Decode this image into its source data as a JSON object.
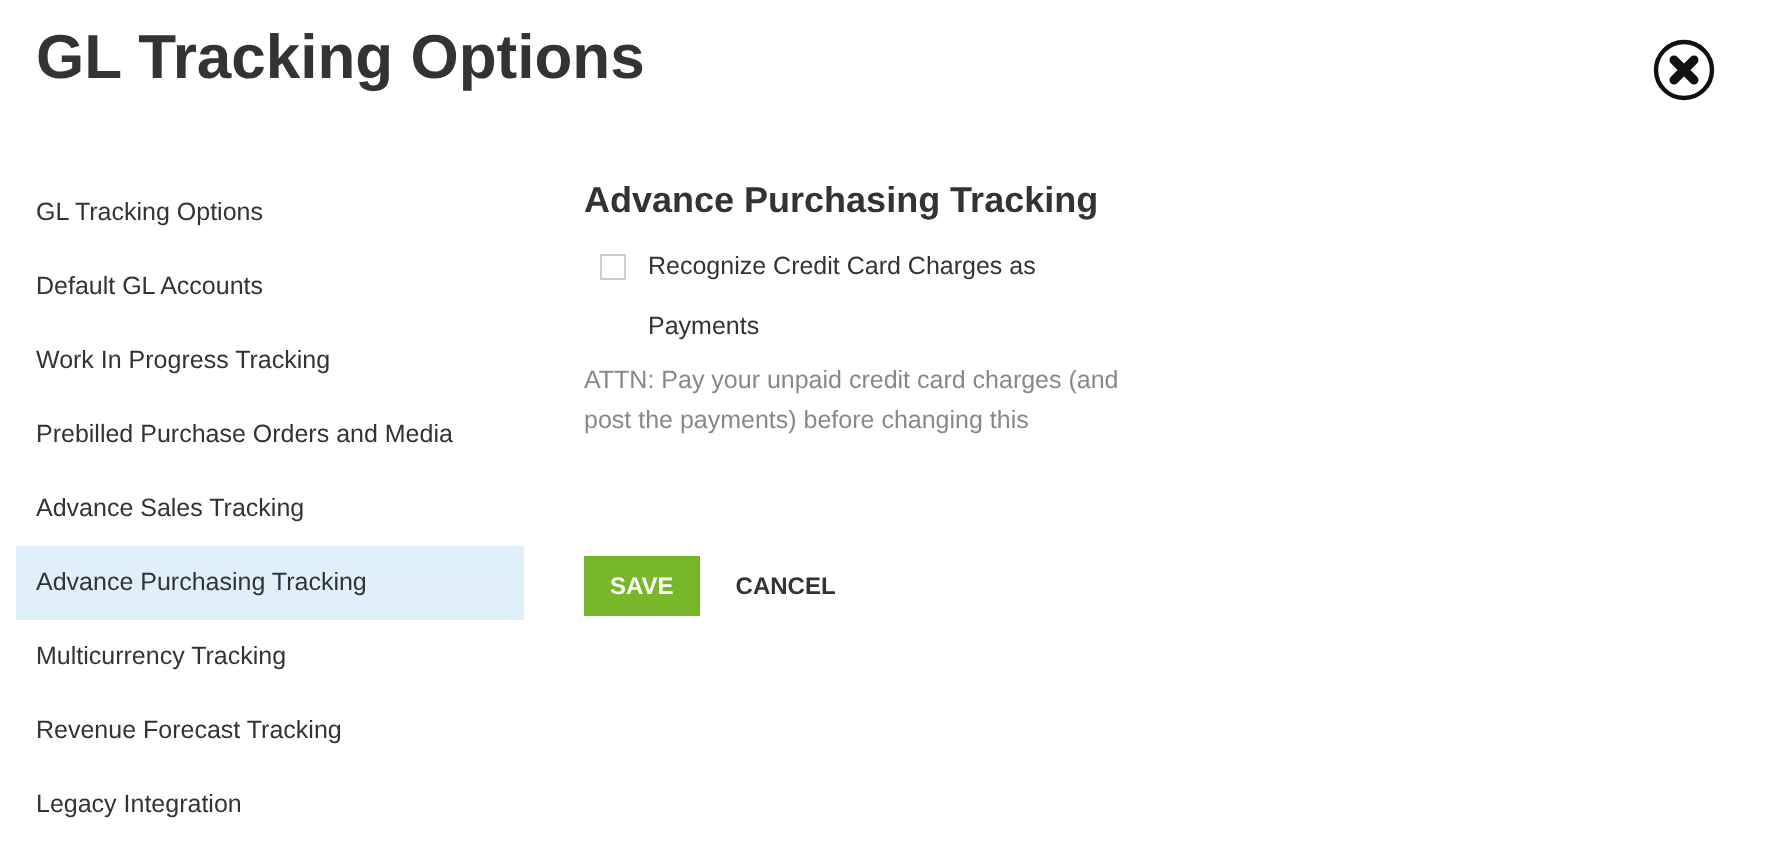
{
  "dialog": {
    "title": "GL Tracking Options"
  },
  "sidebar": {
    "items": [
      {
        "label": "GL Tracking Options",
        "selected": false
      },
      {
        "label": "Default GL Accounts",
        "selected": false
      },
      {
        "label": "Work In Progress Tracking",
        "selected": false
      },
      {
        "label": "Prebilled Purchase Orders and Media",
        "selected": false
      },
      {
        "label": "Advance Sales Tracking",
        "selected": false
      },
      {
        "label": "Advance Purchasing Tracking",
        "selected": true
      },
      {
        "label": "Multicurrency Tracking",
        "selected": false
      },
      {
        "label": "Revenue Forecast Tracking",
        "selected": false
      },
      {
        "label": "Legacy Integration",
        "selected": false
      }
    ]
  },
  "section": {
    "heading": "Advance Purchasing Tracking",
    "option": {
      "label": "Recognize Credit Card Charges as Payments",
      "checked": false
    },
    "note": "ATTN: Pay your unpaid credit card charges (and post the payments) before changing this"
  },
  "buttons": {
    "save": "SAVE",
    "cancel": "CANCEL"
  }
}
